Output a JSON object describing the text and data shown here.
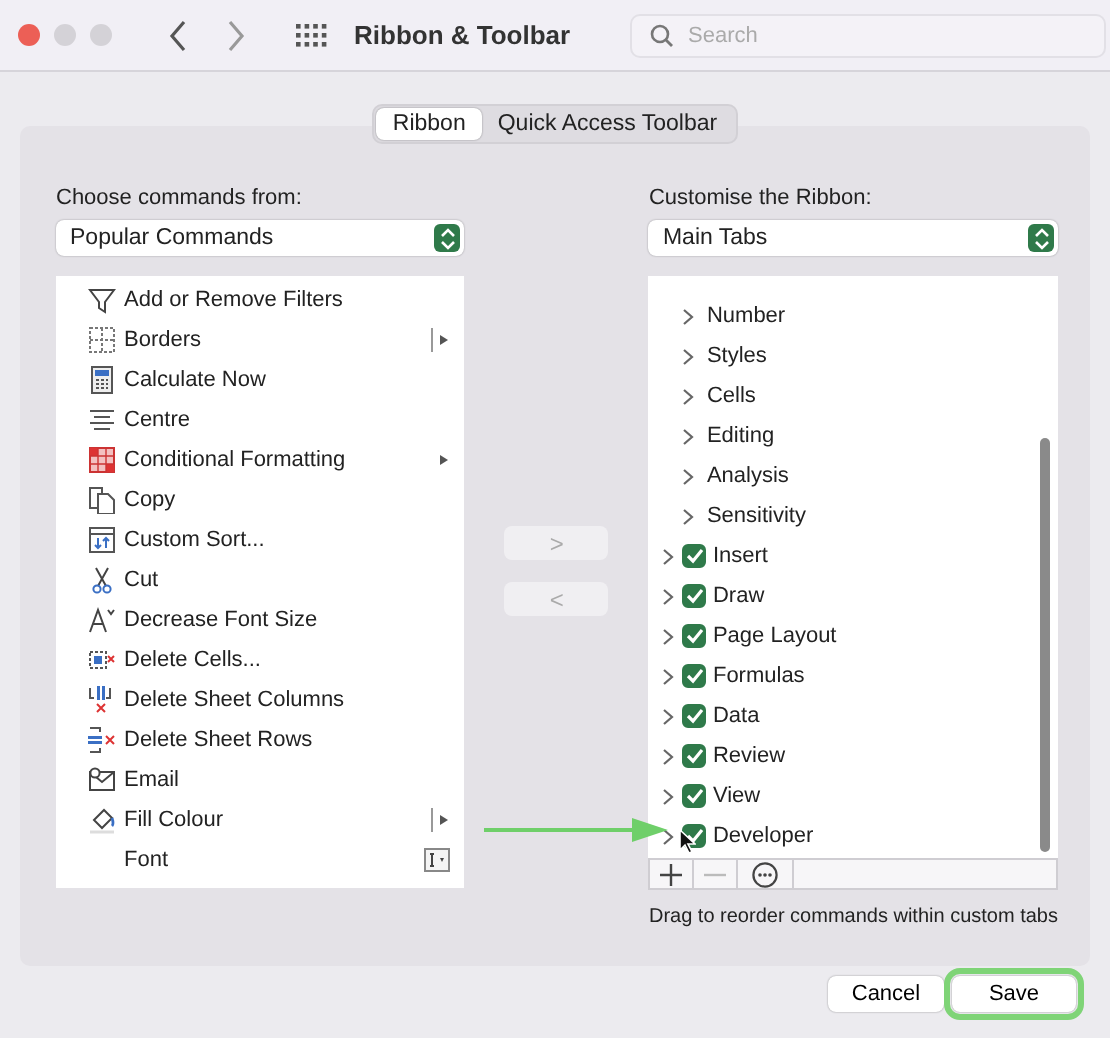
{
  "window": {
    "title": "Ribbon & Toolbar"
  },
  "search": {
    "placeholder": "Search"
  },
  "tabs": [
    {
      "label": "Ribbon",
      "selected": true
    },
    {
      "label": "Quick Access Toolbar",
      "selected": false
    }
  ],
  "commands": {
    "label": "Choose commands from:",
    "source": "Popular Commands",
    "items": [
      {
        "label": "Add or Remove Filters"
      },
      {
        "label": "Borders",
        "kind": "split"
      },
      {
        "label": "Calculate Now"
      },
      {
        "label": "Centre"
      },
      {
        "label": "Conditional Formatting",
        "kind": "arrow"
      },
      {
        "label": "Copy"
      },
      {
        "label": "Custom Sort..."
      },
      {
        "label": "Cut"
      },
      {
        "label": "Decrease Font Size"
      },
      {
        "label": "Delete Cells..."
      },
      {
        "label": "Delete Sheet Columns"
      },
      {
        "label": "Delete Sheet Rows"
      },
      {
        "label": "Email"
      },
      {
        "label": "Fill Colour",
        "kind": "split"
      },
      {
        "label": "Font",
        "kind": "field"
      }
    ]
  },
  "move_buttons": [
    {
      "glyph": ">",
      "disabled": true
    },
    {
      "glyph": "<",
      "disabled": true
    }
  ],
  "ribbon": {
    "label": "Customise the Ribbon:",
    "source": "Main Tabs",
    "items": [
      {
        "children": [
          {
            "label": "Number"
          },
          {
            "label": "Styles"
          },
          {
            "label": "Cells"
          },
          {
            "label": "Editing"
          },
          {
            "label": "Analysis"
          },
          {
            "label": "Sensitivity"
          }
        ]
      },
      {
        "label": "Insert",
        "checked": true
      },
      {
        "label": "Draw",
        "checked": true
      },
      {
        "label": "Page Layout",
        "checked": true
      },
      {
        "label": "Formulas",
        "checked": true
      },
      {
        "label": "Data",
        "checked": true
      },
      {
        "label": "Review",
        "checked": true
      },
      {
        "label": "View",
        "checked": true
      },
      {
        "label": "Developer",
        "checked": true
      }
    ],
    "hint": "Drag to reorder commands within custom tabs"
  },
  "buttons": [
    {
      "label": "Cancel",
      "highlighted": false
    },
    {
      "label": "Save",
      "highlighted": true
    }
  ]
}
